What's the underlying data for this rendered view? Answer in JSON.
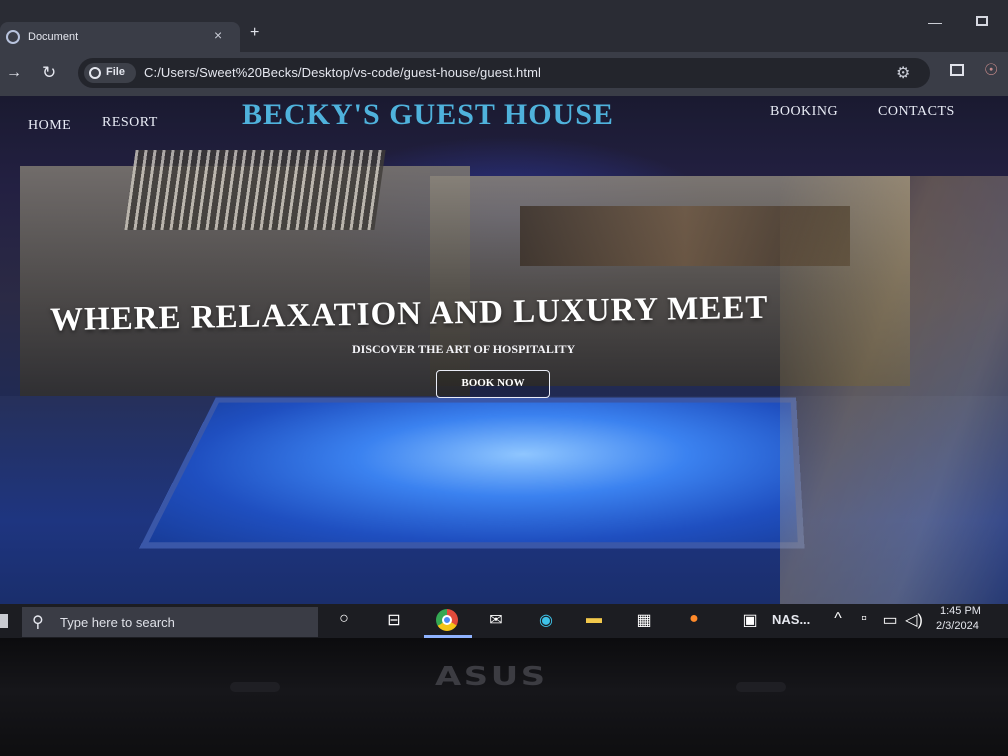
{
  "browser": {
    "tab_title": "Document",
    "tab_close": "×",
    "new_tab": "+",
    "window_minimize": "—",
    "address": {
      "protocol_chip": "File",
      "url": "C:/Users/Sweet%20Becks/Desktop/vs-code/guest-house/guest.html"
    },
    "icons": {
      "back": "→",
      "reload": "↻",
      "extension": "⚙",
      "profile": "☉"
    }
  },
  "site": {
    "nav_left": [
      "HOME",
      "RESORT"
    ],
    "title": "BECKY'S GUEST HOUSE",
    "nav_right": [
      "BOOKING",
      "CONTACTS"
    ],
    "hero": {
      "heading": "WHERE RELAXATION AND LUXURY MEET",
      "subheading": "DISCOVER THE ART OF HOSPITALITY",
      "button": "BOOK NOW"
    },
    "colors": {
      "title": "#4fb2dc",
      "pool": "#3b82f0"
    }
  },
  "taskbar": {
    "search_placeholder": "Type here to search",
    "search_glyph": "⚲",
    "cortana_glyph": "○",
    "taskview_glyph": "⊟",
    "mail_glyph": "✉",
    "edge_glyph": "◉",
    "explorer_glyph": "▬",
    "store_glyph": "▦",
    "firefox_glyph": "●",
    "news_glyph": "▣",
    "news_label": "NAS...",
    "tray_up_glyph": "^",
    "tray_net_glyph": "▫",
    "tray_battery_glyph": "▭",
    "tray_volume_glyph": "◁)",
    "time": "1:45 PM",
    "date": "2/3/2024"
  },
  "device": {
    "brand": "ASUS"
  }
}
